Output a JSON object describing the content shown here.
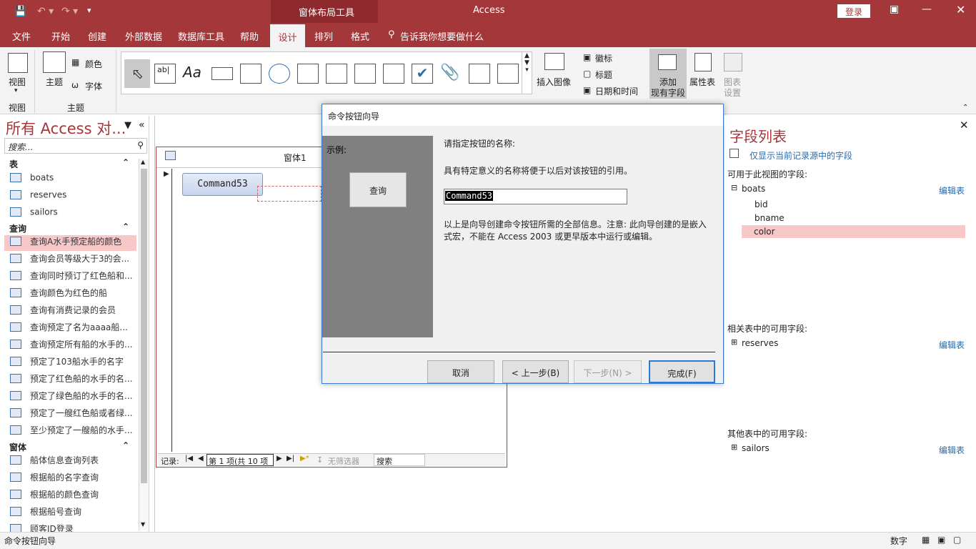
{
  "window": {
    "app_title": "Access",
    "context_tab": "窗体布局工具",
    "login": "登录"
  },
  "ribbon_tabs": [
    "文件",
    "开始",
    "创建",
    "外部数据",
    "数据库工具",
    "帮助",
    "设计",
    "排列",
    "格式"
  ],
  "tell_me": "告诉我你想要做什么",
  "ribbon": {
    "view_label": "视图",
    "view_group": "视图",
    "theme_label": "主题",
    "colors_label": "颜色",
    "fonts_label": "字体",
    "theme_group": "主题",
    "insert_image": "插入图像",
    "logo": "徽标",
    "title": "标题",
    "datetime": "日期和时间",
    "add_fields": "添加\n现有字段",
    "add_fields_1": "添加",
    "add_fields_2": "现有字段",
    "property_sheet": "属性表",
    "chart_settings_1": "图表",
    "chart_settings_2": "设置"
  },
  "nav": {
    "title": "所有 Access 对...",
    "search_placeholder": "搜索...",
    "tables_header": "表",
    "tables": [
      "boats",
      "reserves",
      "sailors"
    ],
    "queries_header": "查询",
    "queries": [
      "查询A水手预定船的颜色",
      "查询会员等级大于3的会...",
      "查询同时预订了红色船和...",
      "查询颜色为红色的船",
      "查询有消费记录的会员",
      "查询预定了名为aaaa船...",
      "查询预定所有船的水手的...",
      "预定了103船水手的名字",
      "预定了红色船的水手的名...",
      "预定了绿色船的水手的名...",
      "预定了一艘红色船或者绿...",
      "至少预定了一艘船的水手..."
    ],
    "forms_header": "窗体",
    "forms": [
      "船体信息查询列表",
      "根据船的名字查询",
      "根据船的颜色查询",
      "根据船号查询",
      "顾客ID登录"
    ]
  },
  "form": {
    "tab_title": "窗体1",
    "command_button": "Command53",
    "record_label": "记录:",
    "record_pos": "第 1 项(共 10 项",
    "no_filter": "无筛选器",
    "search": "搜索"
  },
  "dialog": {
    "title": "命令按钮向导",
    "sample_label": "示例:",
    "sample_button": "查询",
    "prompt": "请指定按钮的名称:",
    "hint": "具有特定意义的名称将便于以后对该按钮的引用。",
    "name_value": "Command53",
    "info": "以上是向导创建命令按钮所需的全部信息。注意: 此向导创建的是嵌入式宏，不能在 Access 2003 或更早版本中运行或编辑。",
    "cancel": "取消",
    "back": "< 上一步(B)",
    "next": "下一步(N) >",
    "finish": "完成(F)"
  },
  "field_list": {
    "title": "字段列表",
    "show_current_only": "仅显示当前记录源中的字段",
    "available_header": "可用于此视图的字段:",
    "table": "boats",
    "fields": [
      "bid",
      "bname",
      "color"
    ],
    "edit_table": "编辑表",
    "related_header": "相关表中的可用字段:",
    "related_table": "reserves",
    "other_header": "其他表中的可用字段:",
    "other_table": "sailors"
  },
  "status": {
    "left": "命令按钮向导",
    "right": "数字"
  },
  "colors": {
    "accent": "#a4373a",
    "selected": "#f8c8c8"
  }
}
